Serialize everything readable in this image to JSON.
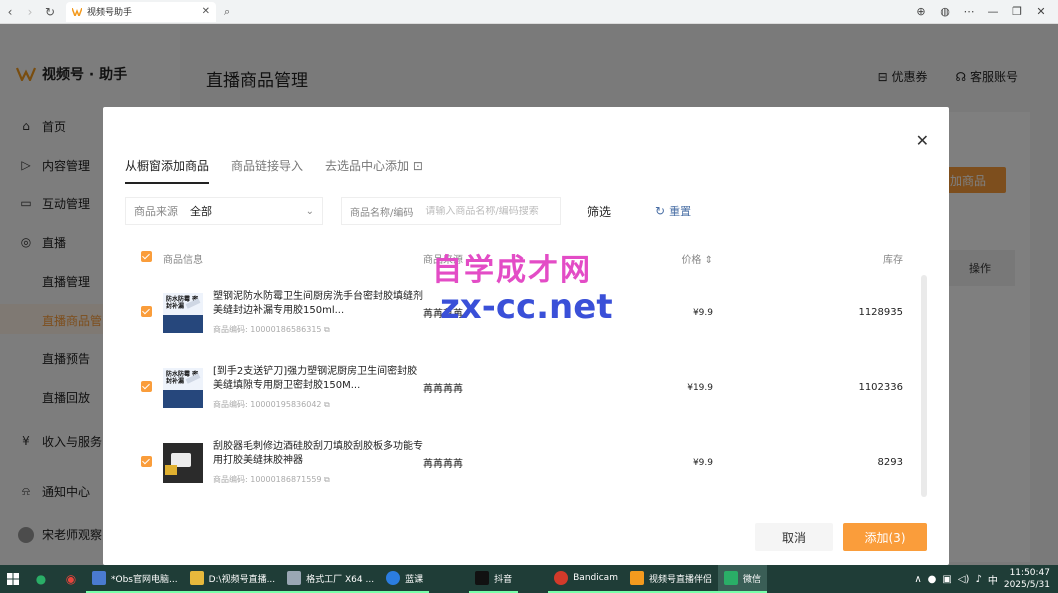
{
  "browser": {
    "tab_title": "视频号助手",
    "close_glyph": "✕"
  },
  "app": {
    "logo_text": "视频号 · 助手",
    "page_title": "直播商品管理",
    "top_actions": [
      "优惠券",
      "客服账号"
    ],
    "sidebar": {
      "items": [
        {
          "label": "首页",
          "icon": "home-icon"
        },
        {
          "label": "内容管理",
          "icon": "content-icon"
        },
        {
          "label": "互动管理",
          "icon": "chat-icon"
        },
        {
          "label": "直播",
          "icon": "live-icon"
        },
        {
          "label": "收入与服务",
          "icon": "money-icon"
        },
        {
          "label": "通知中心",
          "icon": "bell-icon"
        }
      ],
      "sub_items": [
        "直播管理",
        "直播商品管",
        "直播预告",
        "直播回放"
      ],
      "user": "宋老师观察"
    },
    "add_goods_button": "加商品",
    "op_column": "操作"
  },
  "modal": {
    "tabs": [
      "从橱窗添加商品",
      "商品链接导入",
      "去选品中心添加 ⊡"
    ],
    "filter": {
      "source_label": "商品来源",
      "source_value": "全部",
      "name_label": "商品名称/编码",
      "name_placeholder": "请输入商品名称/编码搜索",
      "filter_button": "筛选",
      "reset_button": "重置"
    },
    "columns": {
      "info": "商品信息",
      "source": "商品来源",
      "price": "价格 ⇕",
      "stock": "库存"
    },
    "rows": [
      {
        "title": "塑钢泥防水防霉卫生间厨房洗手台密封胶填缝剂美缝封边补漏专用胶150ml...",
        "code": "商品编码: 10000186586315",
        "source": "苒苒苒苒",
        "price": "¥9.9",
        "stock": "1128935",
        "thumb_text": "防水防霉 密封补漏"
      },
      {
        "title": "[到手2支送铲刀]强力塑钢泥厨房卫生间密封胶美缝填隙专用厨卫密封胶150M...",
        "code": "商品编码: 10000195836042",
        "source": "苒苒苒苒",
        "price": "¥19.9",
        "stock": "1102336",
        "thumb_text": "防水防霉 密封补漏"
      },
      {
        "title": "刮胶器毛刺修边酒硅胶刮刀填胶刮胶板多功能专用打胶美缝抹胶神器",
        "code": "商品编码: 10000186871559",
        "source": "苒苒苒苒",
        "price": "¥9.9",
        "stock": "8293"
      }
    ],
    "cancel_button": "取消",
    "add_button": "添加(3)"
  },
  "watermark": {
    "line1": "自学成才网",
    "line2": "zx-cc.net"
  },
  "taskbar": {
    "apps": [
      {
        "label": "*Obs官网电脑...",
        "color": "#4a7bd0"
      },
      {
        "label": "D:\\视频号直播...",
        "color": "#e7b93c"
      },
      {
        "label": "格式工厂 X64 ...",
        "color": "#9aa7b4"
      },
      {
        "label": "蓝课",
        "color": "#2b7de0"
      },
      {
        "label": "抖音",
        "color": "#111111"
      },
      {
        "label": "Bandicam",
        "color": "#d23a2a"
      },
      {
        "label": "视频号直播伴侣",
        "color": "#f39a1e"
      },
      {
        "label": "微信",
        "color": "#2aae67"
      }
    ],
    "tray_lang": "中",
    "time": "11:50:47",
    "date": "2025/5/31"
  },
  "colors": {
    "accent": "#fa9d3b",
    "link": "#4a6fa5"
  }
}
